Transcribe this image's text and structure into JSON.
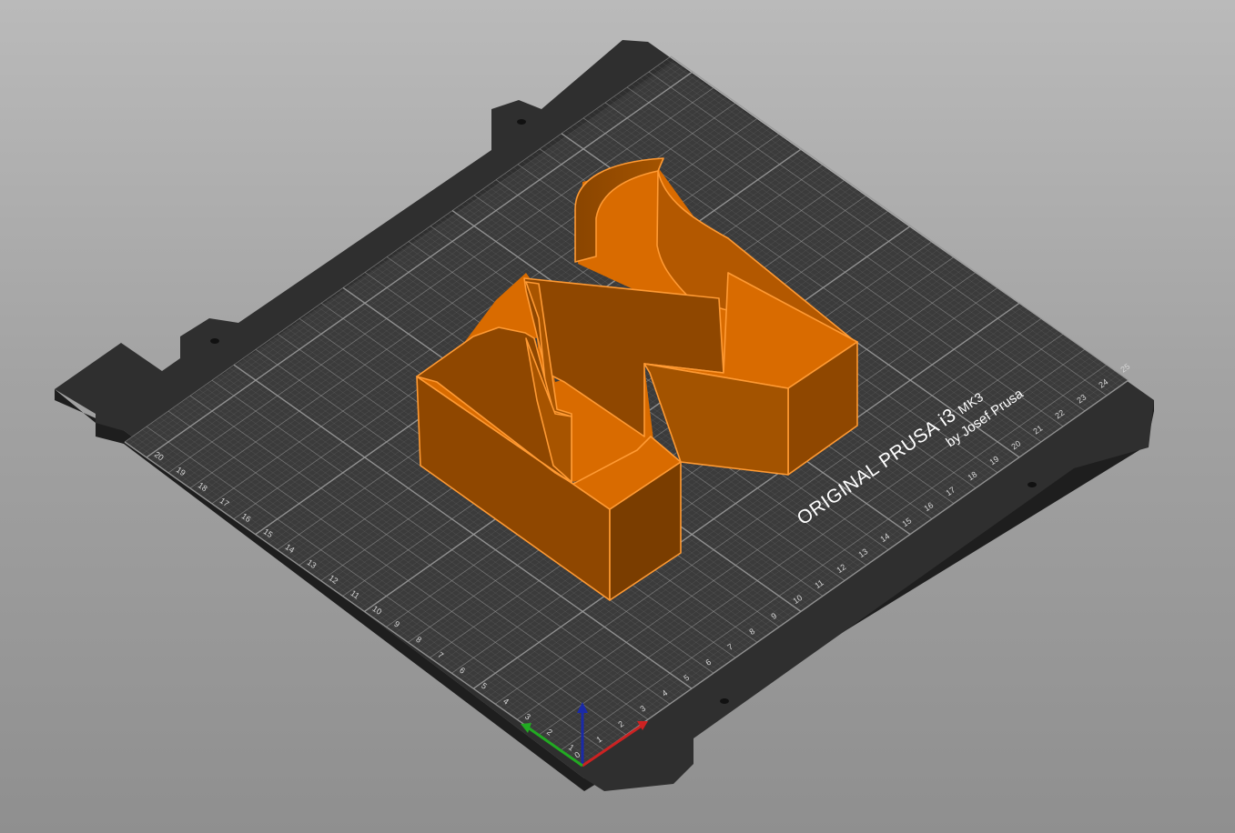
{
  "scene": {
    "background_top": "#bababa",
    "background_bottom": "#8f8f8f",
    "bed_color": "#2b2b2b",
    "sheet_color": "#383838",
    "grid_color": "#8a8a8a",
    "model_color": "#d96b00"
  },
  "bed_branding": {
    "line1_main": "ORIGINAL PRUSA i3",
    "line1_suffix": "MK3",
    "line2": "by Josef Prusa"
  },
  "bed_x_ticks": [
    "0",
    "1",
    "2",
    "3",
    "4",
    "5",
    "6",
    "7",
    "8",
    "9",
    "10",
    "11",
    "12",
    "13",
    "14",
    "15",
    "16",
    "17",
    "18",
    "19",
    "20",
    "21",
    "22",
    "23",
    "24",
    "25"
  ],
  "bed_y_ticks": [
    "1",
    "2",
    "3",
    "4",
    "5",
    "6",
    "7",
    "8",
    "9",
    "10",
    "11",
    "12",
    "13",
    "14",
    "15",
    "16",
    "17",
    "18",
    "19",
    "20"
  ],
  "axes": {
    "x_color": "#cc2222",
    "y_color": "#22aa22",
    "z_color": "#1a2aa8"
  },
  "model": {
    "name": "letter-N-shell",
    "icon": "3d-model-icon"
  }
}
